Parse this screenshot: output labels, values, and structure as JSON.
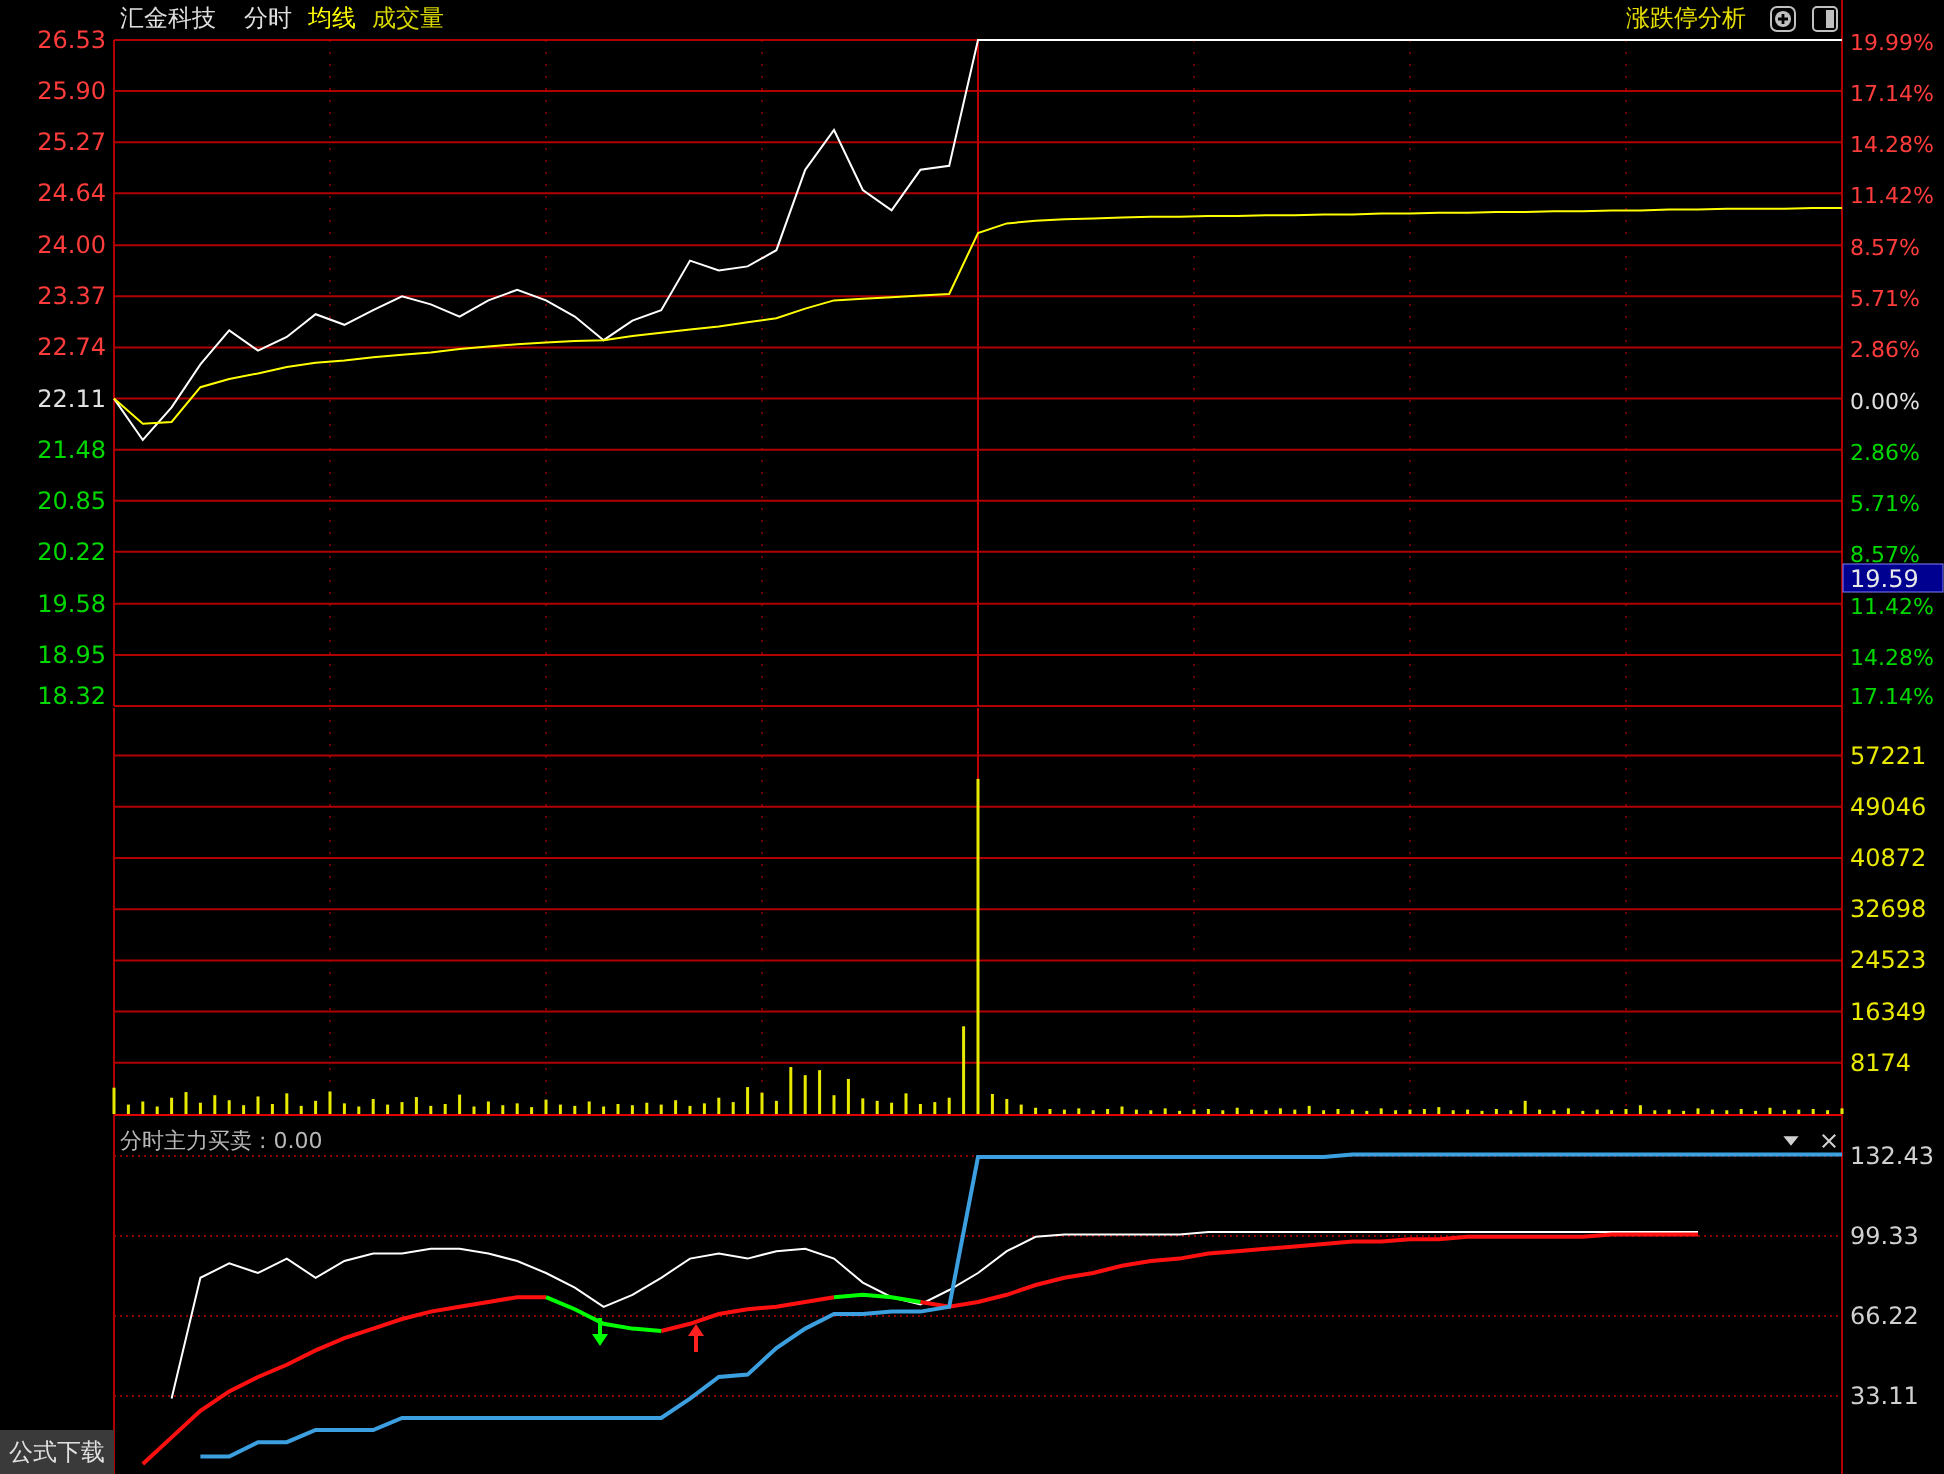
{
  "header": {
    "stock_name": "汇金科技",
    "tabs": [
      {
        "label": "分时",
        "color": "#e0e0e0"
      },
      {
        "label": "均线",
        "color": "#ffff00"
      },
      {
        "label": "成交量",
        "color": "#d8d800"
      }
    ],
    "analysis_link": "涨跌停分析"
  },
  "price_chart": {
    "cursor_label": "19.59",
    "right_axis_labels": [
      {
        "label": "19.99%",
        "color": "#ff3c3c"
      },
      {
        "label": "17.14%",
        "color": "#ff3c3c"
      },
      {
        "label": "14.28%",
        "color": "#ff3c3c"
      },
      {
        "label": "11.42%",
        "color": "#ff3c3c"
      },
      {
        "label": "8.57%",
        "color": "#ff3c3c"
      },
      {
        "label": "5.71%",
        "color": "#ff3c3c"
      },
      {
        "label": "2.86%",
        "color": "#ff3c3c"
      },
      {
        "label": "0.00%",
        "color": "#e0e0e0"
      },
      {
        "label": "2.86%",
        "color": "#00d800"
      },
      {
        "label": "5.71%",
        "color": "#00d800"
      },
      {
        "label": "8.57%",
        "color": "#00d800"
      },
      {
        "label": "11.42%",
        "color": "#00d800"
      },
      {
        "label": "14.28%",
        "color": "#00d800"
      },
      {
        "label": "17.14%",
        "color": "#00d800"
      }
    ],
    "chart_data": {
      "type": "line",
      "grid": true,
      "categories": [
        null,
        null,
        null,
        null,
        null,
        null,
        null,
        null,
        null,
        null,
        null,
        null,
        null,
        null,
        null,
        null,
        null,
        null,
        null,
        null,
        null,
        null,
        null,
        null,
        null,
        null,
        null,
        null,
        null,
        null,
        null,
        null,
        null,
        null,
        null,
        null,
        null,
        null,
        null,
        null,
        null,
        null,
        null,
        null,
        null,
        null,
        null,
        null,
        null,
        null,
        null,
        null,
        null,
        null,
        null,
        null,
        null,
        null,
        null,
        null,
        null
      ],
      "ylim": [
        18.32,
        26.53
      ],
      "yticks": [
        {
          "value": 26.53,
          "label": "26.53"
        },
        {
          "value": 25.9,
          "label": "25.90"
        },
        {
          "value": 25.27,
          "label": "25.27"
        },
        {
          "value": 24.64,
          "label": "24.64"
        },
        {
          "value": 24.0,
          "label": "24.00"
        },
        {
          "value": 23.37,
          "label": "23.37"
        },
        {
          "value": 22.74,
          "label": "22.74"
        },
        {
          "value": 22.11,
          "label": "22.11"
        },
        {
          "value": 21.48,
          "label": "21.48"
        },
        {
          "value": 20.85,
          "label": "20.85"
        },
        {
          "value": 20.22,
          "label": "20.22"
        },
        {
          "value": 19.58,
          "label": "19.58"
        },
        {
          "value": 18.95,
          "label": "18.95"
        },
        {
          "value": 18.32,
          "label": "18.32"
        }
      ],
      "series": [
        {
          "color": "#ffffff",
          "values": [
            22.11,
            21.6,
            22.0,
            22.53,
            22.95,
            22.7,
            22.87,
            23.15,
            23.02,
            23.2,
            23.37,
            23.27,
            23.12,
            23.32,
            23.45,
            23.32,
            23.12,
            22.83,
            23.07,
            23.2,
            23.81,
            23.69,
            23.74,
            23.94,
            24.93,
            25.42,
            24.68,
            24.43,
            24.93,
            24.98,
            26.53,
            26.53,
            26.53,
            26.53,
            26.53,
            26.53,
            26.53,
            26.53,
            26.53,
            26.53,
            26.53,
            26.53,
            26.53,
            26.53,
            26.53,
            26.53,
            26.53,
            26.53,
            26.53,
            26.53,
            26.53,
            26.53,
            26.53,
            26.53,
            26.53,
            26.53,
            26.53,
            26.53,
            26.53,
            26.53,
            26.53
          ]
        },
        {
          "color": "#ffff00",
          "values": [
            22.11,
            21.8,
            21.82,
            22.25,
            22.35,
            22.42,
            22.5,
            22.55,
            22.58,
            22.62,
            22.65,
            22.68,
            22.72,
            22.75,
            22.78,
            22.8,
            22.82,
            22.83,
            22.88,
            22.92,
            22.96,
            23.0,
            23.05,
            23.1,
            23.22,
            23.32,
            23.34,
            23.36,
            23.38,
            23.4,
            24.15,
            24.27,
            24.3,
            24.32,
            24.33,
            24.34,
            24.35,
            24.35,
            24.36,
            24.36,
            24.37,
            24.37,
            24.38,
            24.38,
            24.39,
            24.39,
            24.4,
            24.4,
            24.41,
            24.41,
            24.42,
            24.42,
            24.43,
            24.43,
            24.44,
            24.44,
            24.45,
            24.45,
            24.45,
            24.46,
            24.46
          ]
        }
      ]
    }
  },
  "volume_chart": {
    "chart_data": {
      "type": "bar",
      "grid": true,
      "categories": [
        null,
        null,
        null,
        null,
        null,
        null,
        null,
        null,
        null,
        null,
        null,
        null,
        null,
        null,
        null,
        null,
        null,
        null,
        null,
        null,
        null,
        null,
        null,
        null,
        null,
        null,
        null,
        null,
        null,
        null,
        null,
        null,
        null,
        null,
        null,
        null,
        null,
        null,
        null,
        null,
        null,
        null,
        null,
        null,
        null,
        null,
        null,
        null,
        null,
        null,
        null,
        null,
        null,
        null,
        null,
        null,
        null,
        null,
        null,
        null,
        null,
        null,
        null,
        null,
        null,
        null,
        null,
        null,
        null,
        null,
        null,
        null,
        null,
        null,
        null,
        null,
        null,
        null,
        null,
        null,
        null,
        null,
        null,
        null,
        null,
        null,
        null,
        null,
        null,
        null,
        null,
        null,
        null,
        null,
        null,
        null,
        null,
        null,
        null,
        null,
        null,
        null,
        null,
        null,
        null,
        null,
        null,
        null,
        null,
        null,
        null,
        null,
        null,
        null,
        null,
        null,
        null,
        null,
        null,
        null,
        null
      ],
      "ylim": [
        0,
        64817
      ],
      "yticks": [
        8174,
        16349,
        24523,
        32698,
        40872,
        49046,
        57221
      ],
      "series": [
        {
          "color": "#e8e800",
          "values": [
            4200,
            1500,
            2000,
            1200,
            2600,
            3500,
            1800,
            3000,
            2200,
            1400,
            2800,
            1600,
            3300,
            1300,
            2100,
            3600,
            1700,
            1200,
            2400,
            1500,
            1900,
            2700,
            1300,
            1600,
            3100,
            1200,
            2000,
            1400,
            1700,
            1100,
            2300,
            1500,
            1300,
            2000,
            1200,
            1600,
            1400,
            1800,
            1500,
            2200,
            1300,
            1700,
            2600,
            1900,
            4300,
            3400,
            2100,
            7500,
            6200,
            7000,
            3000,
            5600,
            2500,
            2100,
            1800,
            3300,
            1600,
            1900,
            2600,
            14000,
            53500,
            3200,
            2400,
            1500,
            1000,
            800,
            700,
            900,
            600,
            800,
            1200,
            700,
            600,
            900,
            500,
            700,
            800,
            600,
            1000,
            700,
            600,
            900,
            700,
            1300,
            600,
            800,
            700,
            500,
            900,
            600,
            700,
            800,
            1100,
            600,
            700,
            500,
            800,
            600,
            2100,
            700,
            600,
            900,
            500,
            700,
            600,
            800,
            1400,
            600,
            700,
            500,
            900,
            700,
            600,
            800,
            500,
            1000,
            600,
            700,
            800,
            600,
            900
          ]
        }
      ]
    }
  },
  "indicator": {
    "title": "分时主力买卖 : 0.00",
    "formula_download": "公式下载",
    "chart_data": {
      "type": "line",
      "grid": true,
      "categories": [
        null,
        null,
        null,
        null,
        null,
        null,
        null,
        null,
        null,
        null,
        null,
        null,
        null,
        null,
        null,
        null,
        null,
        null,
        null,
        null,
        null,
        null,
        null,
        null,
        null,
        null,
        null,
        null,
        null,
        null,
        null,
        null,
        null,
        null,
        null,
        null,
        null,
        null,
        null,
        null,
        null,
        null,
        null,
        null,
        null,
        null,
        null,
        null,
        null,
        null,
        null,
        null,
        null,
        null,
        null,
        null,
        null,
        null,
        null,
        null,
        null
      ],
      "ylim": [
        0,
        149.8
      ],
      "yticks": [
        33.11,
        66.22,
        99.33,
        132.43
      ],
      "series": [
        {
          "color": "#ffffff",
          "values": [
            null,
            null,
            32,
            82,
            88,
            84,
            90,
            82,
            89,
            92,
            92,
            94,
            94,
            92,
            89,
            84,
            78,
            70,
            75,
            82,
            90,
            92,
            90,
            93,
            94,
            90,
            80,
            74,
            71,
            77,
            84,
            93,
            99,
            100,
            100,
            100,
            100,
            100,
            101,
            101,
            101,
            101,
            101,
            101,
            101,
            101,
            101,
            101,
            101,
            101,
            101,
            101,
            101,
            101,
            101,
            101,
            null,
            null,
            null,
            null,
            null
          ]
        },
        {
          "color": "#ff1010",
          "values": [
            null,
            5,
            16,
            27,
            35,
            41,
            46,
            52,
            57,
            61,
            65,
            68,
            70,
            72,
            74,
            74,
            null,
            null,
            null,
            60,
            63,
            67,
            69,
            70,
            72,
            74,
            null,
            null,
            72,
            70,
            72,
            75,
            79,
            82,
            84,
            87,
            89,
            90,
            92,
            93,
            94,
            95,
            96,
            97,
            97,
            98,
            98,
            99,
            99,
            99,
            99,
            99,
            100,
            100,
            100,
            100,
            null,
            null,
            null,
            null,
            null
          ]
        },
        {
          "color": "#00ff00",
          "values": [
            null,
            null,
            null,
            null,
            null,
            null,
            null,
            null,
            null,
            null,
            null,
            null,
            null,
            null,
            null,
            74,
            69,
            63,
            61,
            60,
            null,
            null,
            null,
            null,
            null,
            74,
            75,
            74,
            72,
            null,
            null,
            null,
            null,
            null,
            null,
            null,
            null,
            null,
            null,
            null,
            null,
            null,
            null,
            null,
            null,
            null,
            null,
            null,
            null,
            null,
            null,
            null,
            null,
            null,
            null,
            null,
            null,
            null,
            null,
            null,
            null
          ]
        },
        {
          "color": "#3ca0e0",
          "values": [
            null,
            null,
            null,
            8,
            8,
            14,
            14,
            19,
            19,
            19,
            24,
            24,
            24,
            24,
            24,
            24,
            24,
            24,
            24,
            24,
            32,
            41,
            42,
            53,
            61,
            67,
            67,
            68,
            68,
            70,
            132,
            132,
            132,
            132,
            132,
            132,
            132,
            132,
            132,
            132,
            132,
            132,
            132,
            133,
            133,
            133,
            133,
            133,
            133,
            133,
            133,
            133,
            133,
            133,
            133,
            133,
            133,
            133,
            133,
            133,
            133
          ]
        }
      ]
    }
  }
}
